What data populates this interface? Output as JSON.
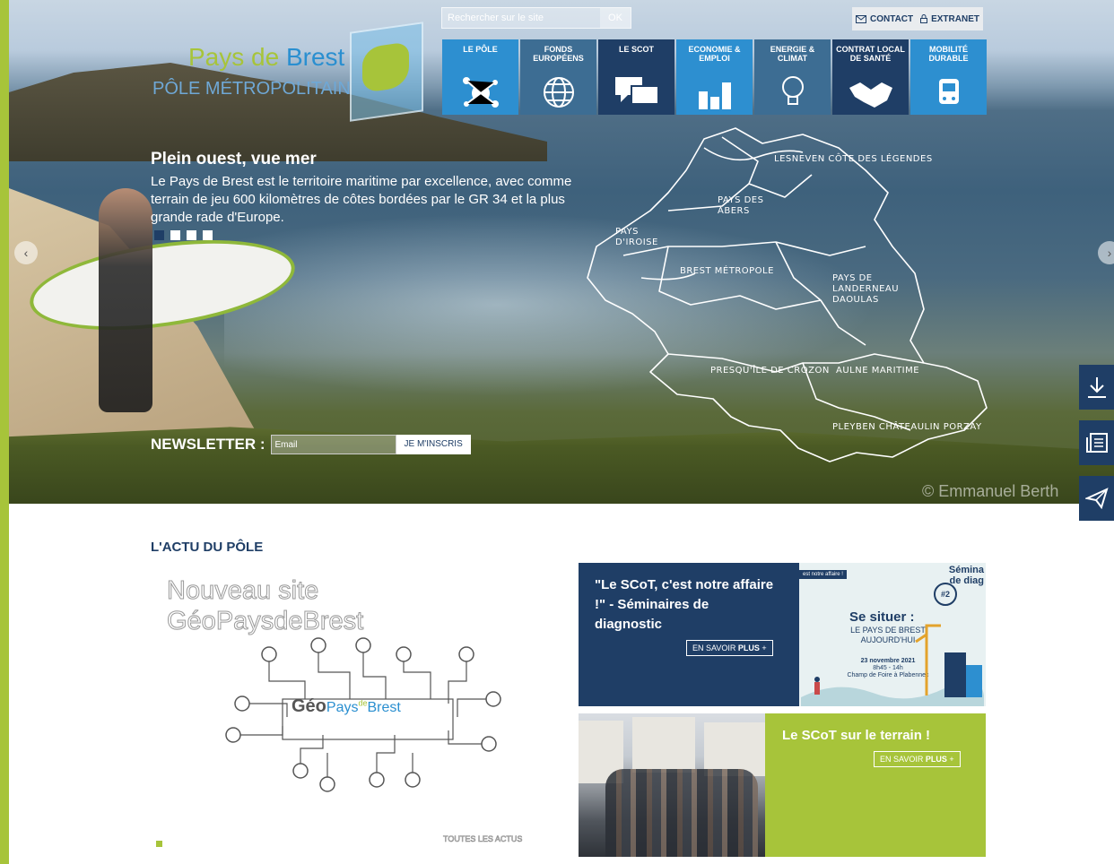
{
  "colors": {
    "green": "#a7c43a",
    "navy": "#1f3e66",
    "blue": "#2a8fd0"
  },
  "logo": {
    "line1_a": "Pays de",
    "line1_b": "Brest",
    "line2": "PÔLE MÉTROPOLITAIN"
  },
  "search": {
    "placeholder": "Rechercher sur le site",
    "button": "OK"
  },
  "utility": {
    "contact": "CONTACT",
    "extranet": "EXTRANET"
  },
  "nav": [
    {
      "label": "LE PÔLE",
      "color": "#2d8fd0",
      "icon": "molecule-icon"
    },
    {
      "label": "FONDS EUROPÉENS",
      "color": "#3d6d93",
      "icon": "globe-icon"
    },
    {
      "label": "LE SCOT",
      "color": "#1f3e66",
      "icon": "speech-bubbles-icon"
    },
    {
      "label": "ECONOMIE & EMPLOI",
      "color": "#2d8fd0",
      "icon": "bar-chart-icon"
    },
    {
      "label": "ENERGIE & CLIMAT",
      "color": "#3d6d93",
      "icon": "lightbulb-icon"
    },
    {
      "label": "CONTRAT LOCAL DE SANTÉ",
      "color": "#1f3e66",
      "icon": "handshake-icon"
    },
    {
      "label": "MOBILITÉ DURABLE",
      "color": "#2d8fd0",
      "icon": "tram-icon"
    }
  ],
  "hero": {
    "title": "Plein ouest, vue mer",
    "text": "Le Pays de Brest est le territoire maritime par excellence, avec comme terrain de jeu 600 kilomètres de côtes bordées par le GR 34 et la plus grande rade d'Europe.",
    "credit": "© Emmanuel Berth",
    "slides_total": 4,
    "slide_active": 1
  },
  "map_regions": [
    {
      "name": "LESNEVEN CÔTE DES LÉGENDES"
    },
    {
      "name": "PAYS DES ABERS"
    },
    {
      "name": "PAYS D'IROISE"
    },
    {
      "name": "BREST MÉTROPOLE"
    },
    {
      "name": "PAYS DE LANDERNEAU DAOULAS"
    },
    {
      "name": "PRESQU'ÎLE DE CROZON"
    },
    {
      "name": "AULNE MARITIME"
    },
    {
      "name": "PLEYBEN CHÂTEAULIN PORZAY"
    }
  ],
  "newsletter": {
    "label": "NEWSLETTER :",
    "placeholder": "Email",
    "button": "JE M'INSCRIS"
  },
  "side_buttons": [
    "download-icon",
    "documents-icon",
    "send-icon"
  ],
  "actu": {
    "title": "L'ACTU DU PÔLE",
    "feature_line1": "Nouveau site",
    "feature_line2": "GéoPaysdeBrest",
    "geo_logo_a": "Géo",
    "geo_logo_b": "Pays",
    "geo_logo_c": "de",
    "geo_logo_d": "Brest",
    "all_news": "TOUTES LES ACTUS"
  },
  "cards": [
    {
      "title": "\"Le SCoT, c'est notre affaire !\" - Séminaires de diagnostic",
      "more_a": "EN SAVOIR ",
      "more_b": "PLUS",
      "poster": {
        "header": "est notre affaire !",
        "tag_line1": "Sémina",
        "tag_line2": "de diag",
        "number": "#2",
        "headline": "Se situer :",
        "subtitle": "LE PAYS DE BREST AUJOURD'HUI",
        "date": "23 novembre 2021",
        "time": "8h45 - 14h",
        "place": "Champ de Foire à Plabennec"
      }
    },
    {
      "title": "Le SCoT sur le terrain !",
      "more_a": "EN SAVOIR ",
      "more_b": "PLUS"
    }
  ]
}
